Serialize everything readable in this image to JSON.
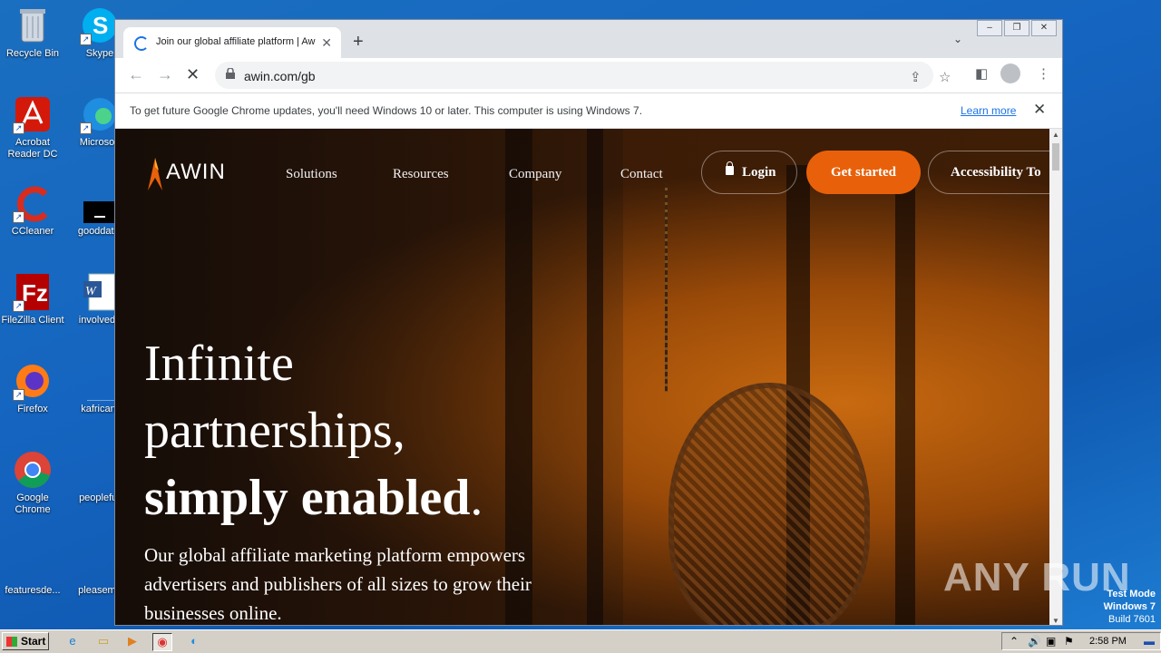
{
  "desktop": {
    "icons": [
      {
        "label": "Recycle Bin"
      },
      {
        "label": "Skype"
      },
      {
        "label": "Acrobat Reader DC"
      },
      {
        "label": "Microsoft"
      },
      {
        "label": "CCleaner"
      },
      {
        "label": "gooddatin"
      },
      {
        "label": "FileZilla Client"
      },
      {
        "label": "involvedg"
      },
      {
        "label": "Firefox"
      },
      {
        "label": "kafrican."
      },
      {
        "label": "Google Chrome"
      },
      {
        "label": "peoplefur"
      },
      {
        "label": "featuresde..."
      },
      {
        "label": "pleaseme"
      }
    ]
  },
  "browser": {
    "tab_title": "Join our global affiliate platform | Aw",
    "url": "awin.com/gb",
    "infobar_message": "To get future Google Chrome updates, you'll need Windows 10 or later. This computer is using Windows 7.",
    "infobar_link": "Learn more"
  },
  "site": {
    "logo_text": "AWIN",
    "nav": [
      "Solutions",
      "Resources",
      "Company",
      "Contact"
    ],
    "login_label": "Login",
    "get_started_label": "Get started",
    "accessibility_label": "Accessibility To",
    "hero_line1": "Infinite",
    "hero_line2": "partnerships,",
    "hero_line3_bold": "simply enabled",
    "hero_line3_end": ".",
    "hero_sub": "Our global affiliate marketing platform empowers advertisers and publishers of all sizes to grow their businesses online."
  },
  "overlay": {
    "watermark": "ANY RUN",
    "test_mode": "Test Mode",
    "os": "Windows 7",
    "build": "Build 7601"
  },
  "taskbar": {
    "start_label": "Start",
    "clock": "2:58 PM"
  },
  "colors": {
    "accent": "#e8610a",
    "link": "#1a73e8"
  }
}
